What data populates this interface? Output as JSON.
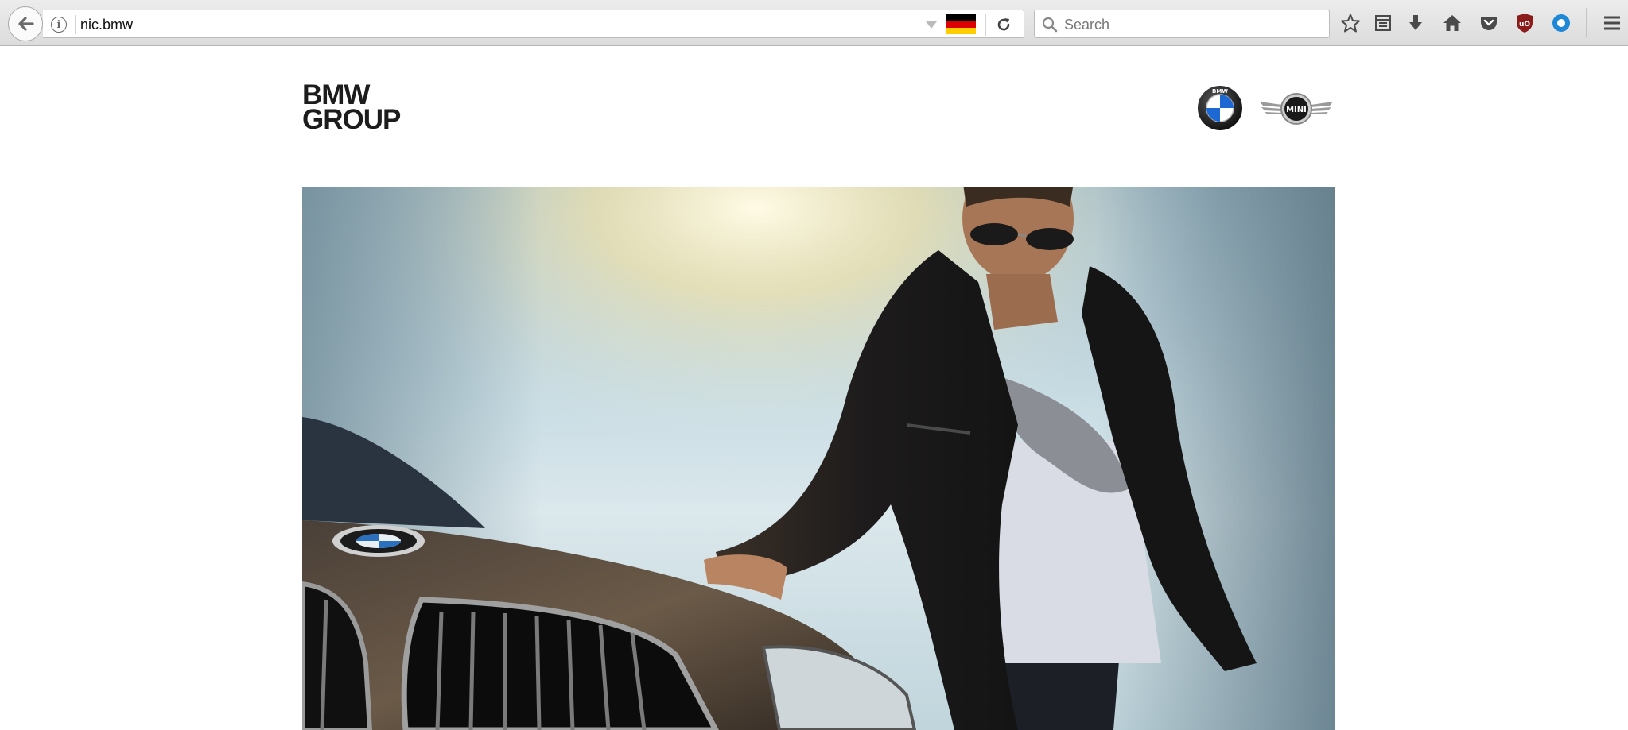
{
  "browser": {
    "url": "nic.bmw",
    "search_placeholder": "Search",
    "flag_colors": [
      "#000000",
      "#dd0000",
      "#ffce00"
    ]
  },
  "icons": [
    "back-arrow-icon",
    "info-icon",
    "dropdown-icon",
    "flag-germany-icon",
    "reload-icon",
    "search-icon",
    "bookmark-star-icon",
    "reading-list-icon",
    "download-icon",
    "home-icon",
    "pocket-icon",
    "ublock-icon",
    "extension-circle-icon",
    "hamburger-menu-icon"
  ],
  "page": {
    "logo_line1": "BMW",
    "logo_line2": "GROUP",
    "bmw_roundel_text": "BMW",
    "mini_logo_text": "MINI"
  },
  "colors": {
    "ublock": "#8b1c1c",
    "extension": "#1e87d6",
    "bmw_blue": "#1c69d4"
  }
}
